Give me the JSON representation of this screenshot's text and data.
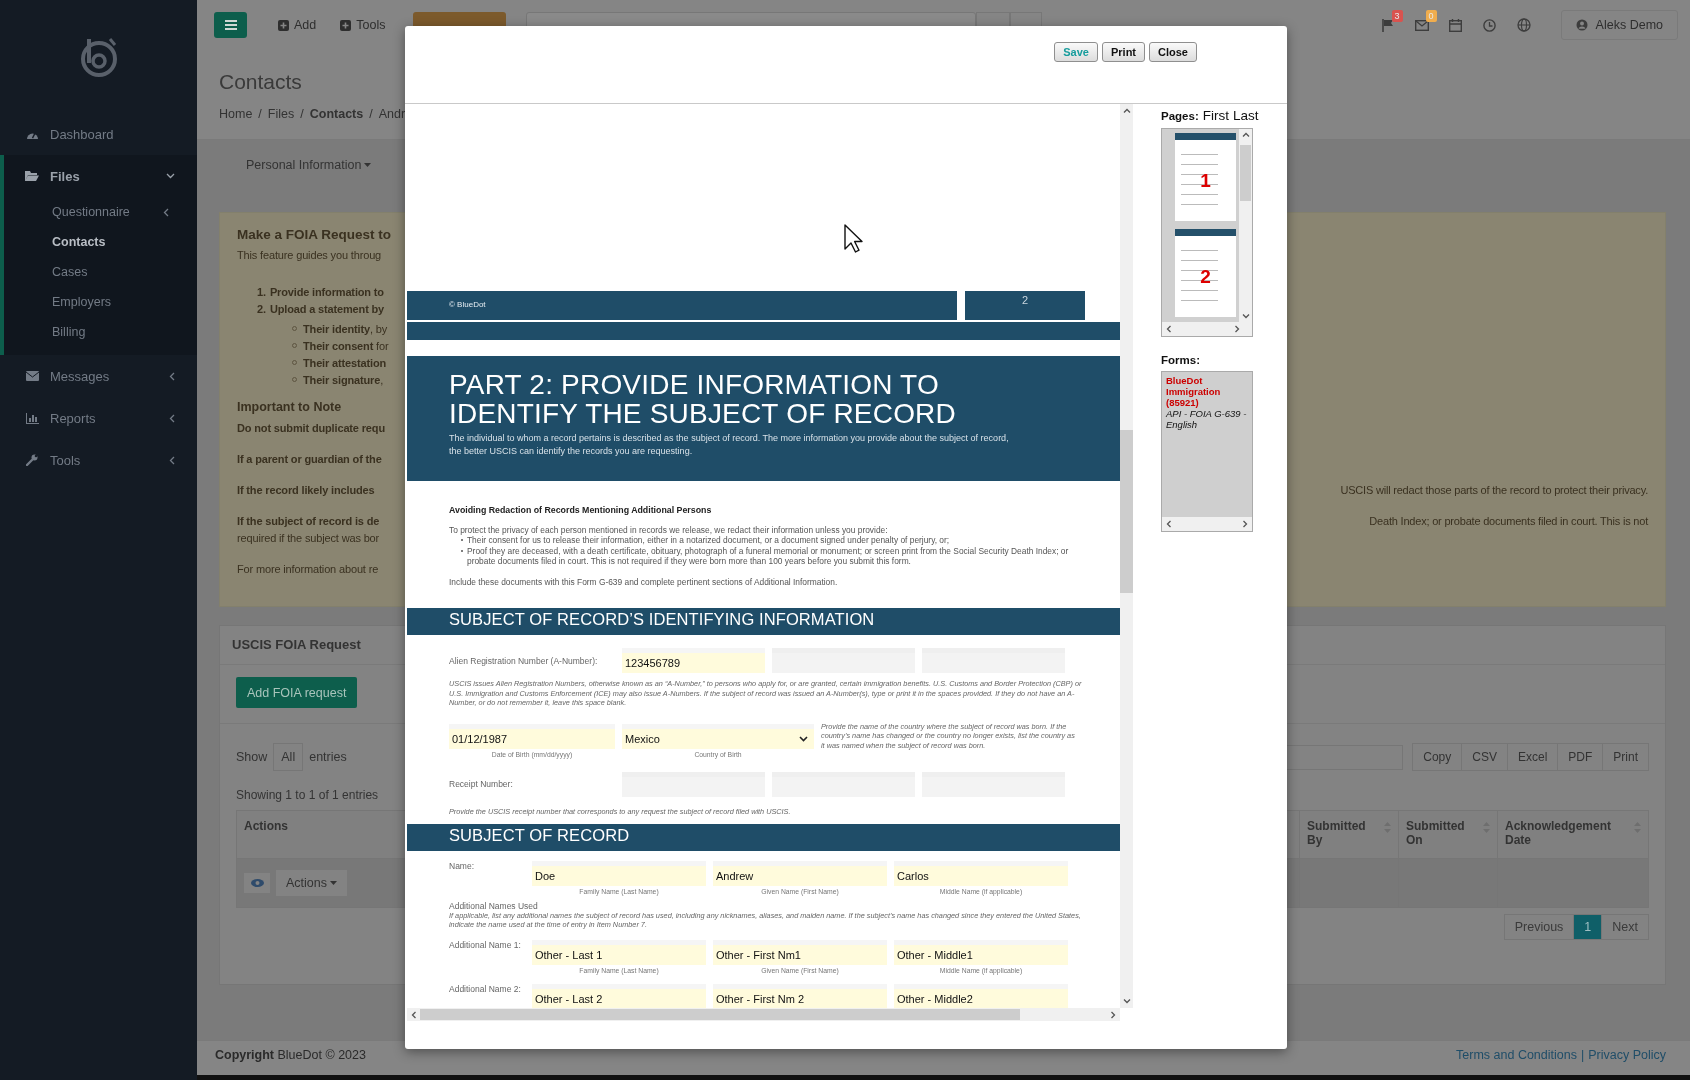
{
  "sidebar": {
    "items": [
      {
        "label": "Dashboard"
      },
      {
        "label": "Files",
        "expanded": true,
        "children": [
          {
            "label": "Questionnaire",
            "expanded": false,
            "selected": false
          },
          {
            "label": "Contacts",
            "selected": true
          },
          {
            "label": "Cases",
            "selected": false
          },
          {
            "label": "Employers",
            "selected": false
          },
          {
            "label": "Billing",
            "selected": false
          }
        ]
      },
      {
        "label": "Messages",
        "expanded": false
      },
      {
        "label": "Reports",
        "expanded": false
      },
      {
        "label": "Tools",
        "expanded": false
      }
    ]
  },
  "topbar": {
    "buttons": [
      "Add",
      "Tools"
    ],
    "notifications": [
      {
        "count": "3",
        "color": "#d9534f"
      },
      {
        "count": "0",
        "color": "#f0ad4e"
      }
    ],
    "user": "Aleks Demo"
  },
  "page": {
    "title": "Contacts",
    "breadcrumb_separator": "/",
    "breadcrumb": [
      {
        "label": "Home",
        "current": false
      },
      {
        "label": "Files",
        "current": false
      },
      {
        "label": "Contacts",
        "current": true
      },
      {
        "label": "Andr",
        "current": false
      }
    ],
    "tab": "Personal Information"
  },
  "notice": {
    "title": "Make a FOIA Request to",
    "intro": "This feature guides you throug",
    "steps": [
      {
        "number": "1.",
        "text": "Provide information to"
      },
      {
        "number": "2.",
        "text": "Upload a statement by",
        "children": [
          "**Their identity**, by",
          "**Their consent** for",
          "**Their attestation**",
          "**Their signature**,"
        ]
      }
    ],
    "note_title": "Important to Note",
    "notes": [
      {
        "text": "Do not submit duplicate requ",
        "bold": true
      },
      {
        "text": "If a parent or guardian of the",
        "bold": true
      },
      {
        "text": "If the record likely includes",
        "bold": true,
        "right": "USCIS will redact those parts of the record to protect their privacy."
      },
      {
        "text": "If the subject of record is de",
        "bold": true,
        "right": "Death Index; or probate documents filed in court. This is not"
      },
      {
        "text": "required if the subject was bor",
        "bold": false
      },
      {
        "text": "For more information about re",
        "bold": false
      }
    ]
  },
  "panel": {
    "title": "USCIS FOIA Request",
    "add_button": "Add FOIA request",
    "show_label": "Show",
    "show_value": "All",
    "entries_label": "entries",
    "export_buttons": [
      "Copy",
      "CSV",
      "Excel",
      "PDF",
      "Print"
    ],
    "info": "Showing 1 to 1 of 1 entries",
    "columns": [
      {
        "label": "Actions",
        "sortable": false
      },
      {
        "label": "Submitted By",
        "sortable": true
      },
      {
        "label": "Submitted On",
        "sortable": true
      },
      {
        "label": "Acknowledgement Date",
        "sortable": true
      }
    ],
    "row_action": "Actions",
    "pagination": [
      {
        "label": "Previous",
        "selected": false
      },
      {
        "label": "1",
        "selected": true
      },
      {
        "label": "Next",
        "selected": false
      }
    ]
  },
  "footer": {
    "copyright": "**Copyright** BlueDot © 2023",
    "links": [
      "Terms and Conditions",
      "Privacy Policy"
    ],
    "separator": "|"
  },
  "modal": {
    "buttons": [
      {
        "label": "Save",
        "kind": "primary"
      },
      {
        "label": "Print",
        "kind": "default"
      },
      {
        "label": "Close",
        "kind": "default"
      }
    ],
    "pages_label": "Pages:",
    "page_links": [
      "First",
      "Last"
    ],
    "thumbnails": [
      "1",
      "2"
    ],
    "forms_label": "Forms:",
    "forms": [
      {
        "name": "BlueDot Immigration (85921)",
        "description": "API - FOIA G-639 - English"
      }
    ],
    "document": {
      "footer_band": {
        "copyright": "© BlueDot",
        "page": "2"
      },
      "part_title": "PART 2: PROVIDE INFORMATION TO IDENTIFY THE SUBJECT OF RECORD",
      "part_subtitle": "The individual to whom a record pertains is described as the subject of record. The more information you provide about the subject of record, the better USCIS can identify the records you are requesting.",
      "redaction": {
        "heading": "Avoiding Redaction of Records Mentioning Additional Persons",
        "intro": "To protect the privacy of each person mentioned in records we release, we redact their information unless you provide:",
        "bullets": [
          "Their consent for us to release their information, either in a notarized document, or a document signed under penalty of perjury, or;",
          "Proof they are deceased, with a death certificate, obituary, photograph of a funeral memorial or monument; or screen print from the Social Security Death Index; or probate documents filed in court. This is not required if they were born more than 100 years before you submit this form."
        ],
        "closing": "Include these documents with this Form G-639 and complete pertinent sections of Additional Information."
      },
      "identifying": {
        "title": "SUBJECT OF RECORD’S IDENTIFYING INFORMATION",
        "a_number": {
          "label": "Alien Registration Number (A-Number):",
          "fields": [
            {
              "kind": "filled",
              "value": "123456789"
            },
            {
              "kind": "blank"
            },
            {
              "kind": "blank"
            }
          ],
          "note": "USCIS issues Alien Registration Numbers, otherwise known as an “A-Number,” to persons who apply for, or are granted, certain immigration benefits. U.S. Customs and Border Protection (CBP) or U.S. Immigration and Customs Enforcement (ICE) may also issue A-Numbers. If the subject of record was issued an A-Number(s), type or print it in the spaces provided. If they do not have an A-Number, or do not remember it, leave this space blank."
        },
        "birth_date": {
          "value": "01/12/1987",
          "caption": "Date of Birth (mm/dd/yyyy)"
        },
        "birth_country": {
          "value": "Mexico",
          "caption": "Country of Birth"
        },
        "country_note": "Provide the name of the country where the subject of record was born. If the country’s name has changed or the country no longer exists, list the country as it was named when the subject of record was born.",
        "receipt": {
          "label": "Receipt Number:",
          "fields": [
            {
              "kind": "blank"
            },
            {
              "kind": "blank"
            },
            {
              "kind": "blank"
            }
          ],
          "note": "Provide the USCIS receipt number that corresponds to any request the subject of record filed with USCIS."
        }
      },
      "subject": {
        "title": "SUBJECT OF RECORD",
        "name": {
          "label": "Name:",
          "fields": [
            {
              "value": "Doe",
              "caption": "Family Name (Last Name)"
            },
            {
              "value": "Andrew",
              "caption": "Given Name (First Name)"
            },
            {
              "value": "Carlos",
              "caption": "Middle Name (if applicable)"
            }
          ]
        },
        "additional_heading": "Additional Names Used",
        "additional_note": "If applicable, list any additional names the subject of record has used, including any nicknames, aliases, and maiden name. If the subject’s name has changed since they entered the United States, indicate the name used at the time of entry in Item Number 7.",
        "additional": [
          {
            "label": "Additional Name 1:",
            "fields": [
              {
                "value": "Other - Last 1",
                "caption": "Family Name (Last Name)"
              },
              {
                "value": "Other - First Nm1",
                "caption": "Given Name (First Name)"
              },
              {
                "value": "Other - Middle1",
                "caption": "Middle Name (if applicable)"
              }
            ]
          },
          {
            "label": "Additional Name 2:",
            "fields": [
              {
                "value": "Other - Last 2"
              },
              {
                "value": "Other - First Nm 2"
              },
              {
                "value": "Other - Middle2"
              }
            ]
          }
        ]
      }
    }
  }
}
